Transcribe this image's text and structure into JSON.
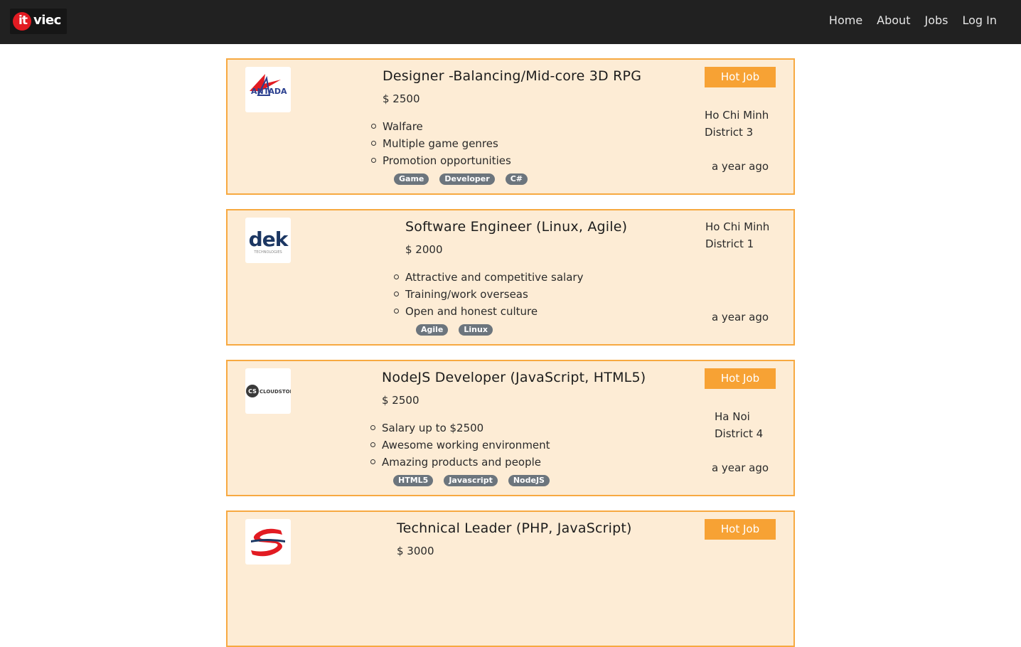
{
  "brand": {
    "logo_text_it": "it",
    "logo_text_viec": "viec"
  },
  "nav": {
    "links": [
      "Home",
      "About",
      "Jobs",
      "Log In"
    ]
  },
  "jobs": [
    {
      "company_logo_text": "ANTADA",
      "title": "Designer -Balancing/Mid-core 3D RPG",
      "salary": "$ 2500",
      "benefits": [
        "Walfare",
        "Multiple game genres",
        "Promotion opportunities"
      ],
      "tags": [
        "Game",
        "Developer",
        "C#"
      ],
      "hot_label": "Hot Job",
      "city": "Ho Chi Minh",
      "district": "District 3",
      "posted": "a year ago"
    },
    {
      "company_logo_text": "dek",
      "company_logo_subtext": "TECHNOLOGIES",
      "title": "Software Engineer (Linux, Agile)",
      "salary": "$ 2000",
      "benefits": [
        "Attractive and competitive salary",
        "Training/work overseas",
        "Open and honest culture"
      ],
      "tags": [
        "Agile",
        "Linux"
      ],
      "hot_label": "",
      "city": "Ho Chi Minh",
      "district": "District 1",
      "posted": "a year ago"
    },
    {
      "company_logo_text": "CLOUDSTORM",
      "company_logo_initials": "CS",
      "title": "NodeJS Developer (JavaScript, HTML5)",
      "salary": "$ 2500",
      "benefits": [
        "Salary up to $2500",
        "Awesome working environment",
        "Amazing products and people"
      ],
      "tags": [
        "HTML5",
        "Javascript",
        "NodeJS"
      ],
      "hot_label": "Hot Job",
      "city": "Ha Noi",
      "district": "District 4",
      "posted": "a year ago"
    },
    {
      "title": "Technical Leader (PHP, JavaScript)",
      "salary": "$ 3000",
      "hot_label": "Hot Job"
    }
  ],
  "colors": {
    "navbar_bg": "#212121",
    "card_bg": "#fdecd5",
    "card_border": "#f7a941",
    "hot_badge": "#f7a234",
    "tag_bg": "#6c757d",
    "logo_red": "#e21b22"
  }
}
